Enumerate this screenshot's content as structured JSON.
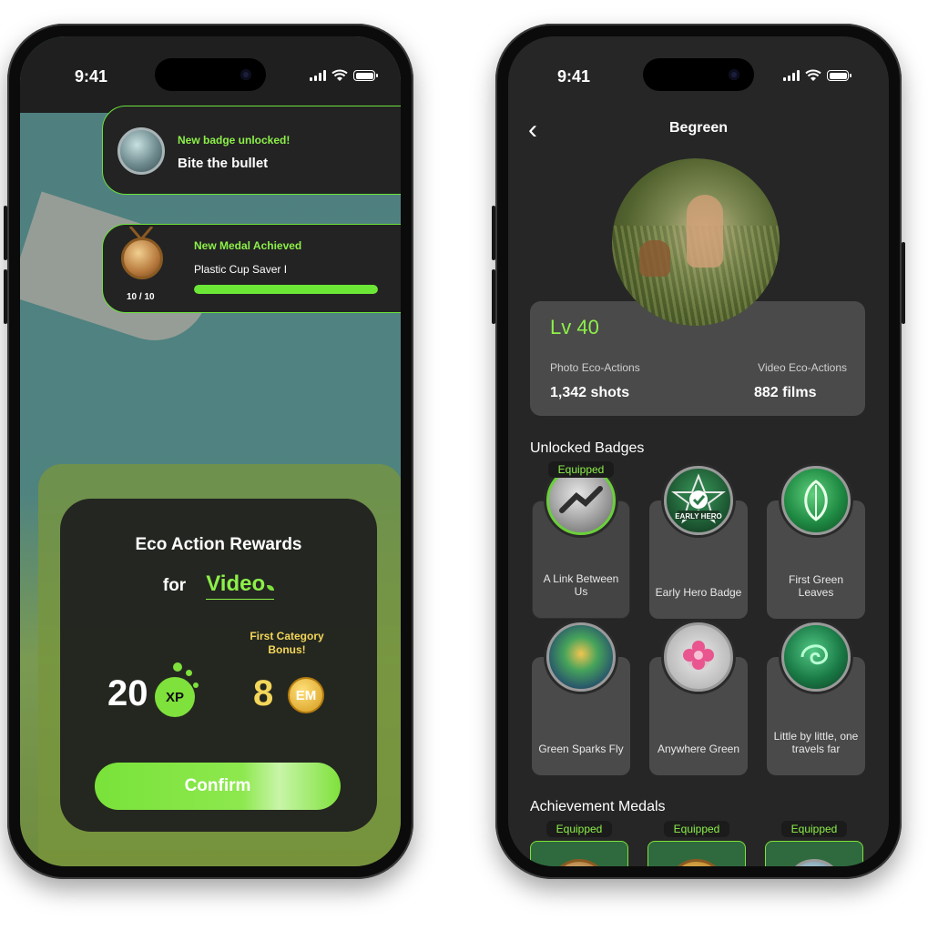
{
  "status_bar": {
    "time": "9:41"
  },
  "left_phone": {
    "notification_badge": {
      "title": "New badge unlocked!",
      "name": "Bite the bullet"
    },
    "notification_medal": {
      "title": "New Medal Achieved",
      "name": "Plastic Cup Saver I",
      "count": "10 / 10",
      "progress": 1.0
    },
    "rewards": {
      "heading": "Eco Action Rewards",
      "for_label": "for",
      "category": "Video",
      "bonus": "First Category Bonus!",
      "xp_value": "20",
      "xp_label": "XP",
      "em_value": "8",
      "em_label": "EM",
      "confirm_label": "Confirm"
    },
    "colors": {
      "accent": "#7fe13c",
      "gold": "#f3d65a"
    }
  },
  "right_phone": {
    "title": "Begreen",
    "level": "Lv 40",
    "photo_label": "Photo Eco-Actions",
    "photo_value": "1,342 shots",
    "video_label": "Video Eco-Actions",
    "video_value": "882 films",
    "badges_heading": "Unlocked Badges",
    "equipped_label": "Equipped",
    "badges": [
      {
        "label": "A Link Between Us",
        "equipped": true
      },
      {
        "label": "Early Hero Badge",
        "equipped": false,
        "emblem": "EARLY HERO"
      },
      {
        "label": "First Green Leaves",
        "equipped": false
      },
      {
        "label": "Green Sparks Fly",
        "equipped": false
      },
      {
        "label": "Anywhere Green",
        "equipped": false
      },
      {
        "label": "Little by little, one travels far",
        "equipped": false
      }
    ],
    "medals_heading": "Achievement Medals",
    "medals": [
      {
        "equipped": true
      },
      {
        "equipped": true
      },
      {
        "equipped": true
      }
    ]
  }
}
